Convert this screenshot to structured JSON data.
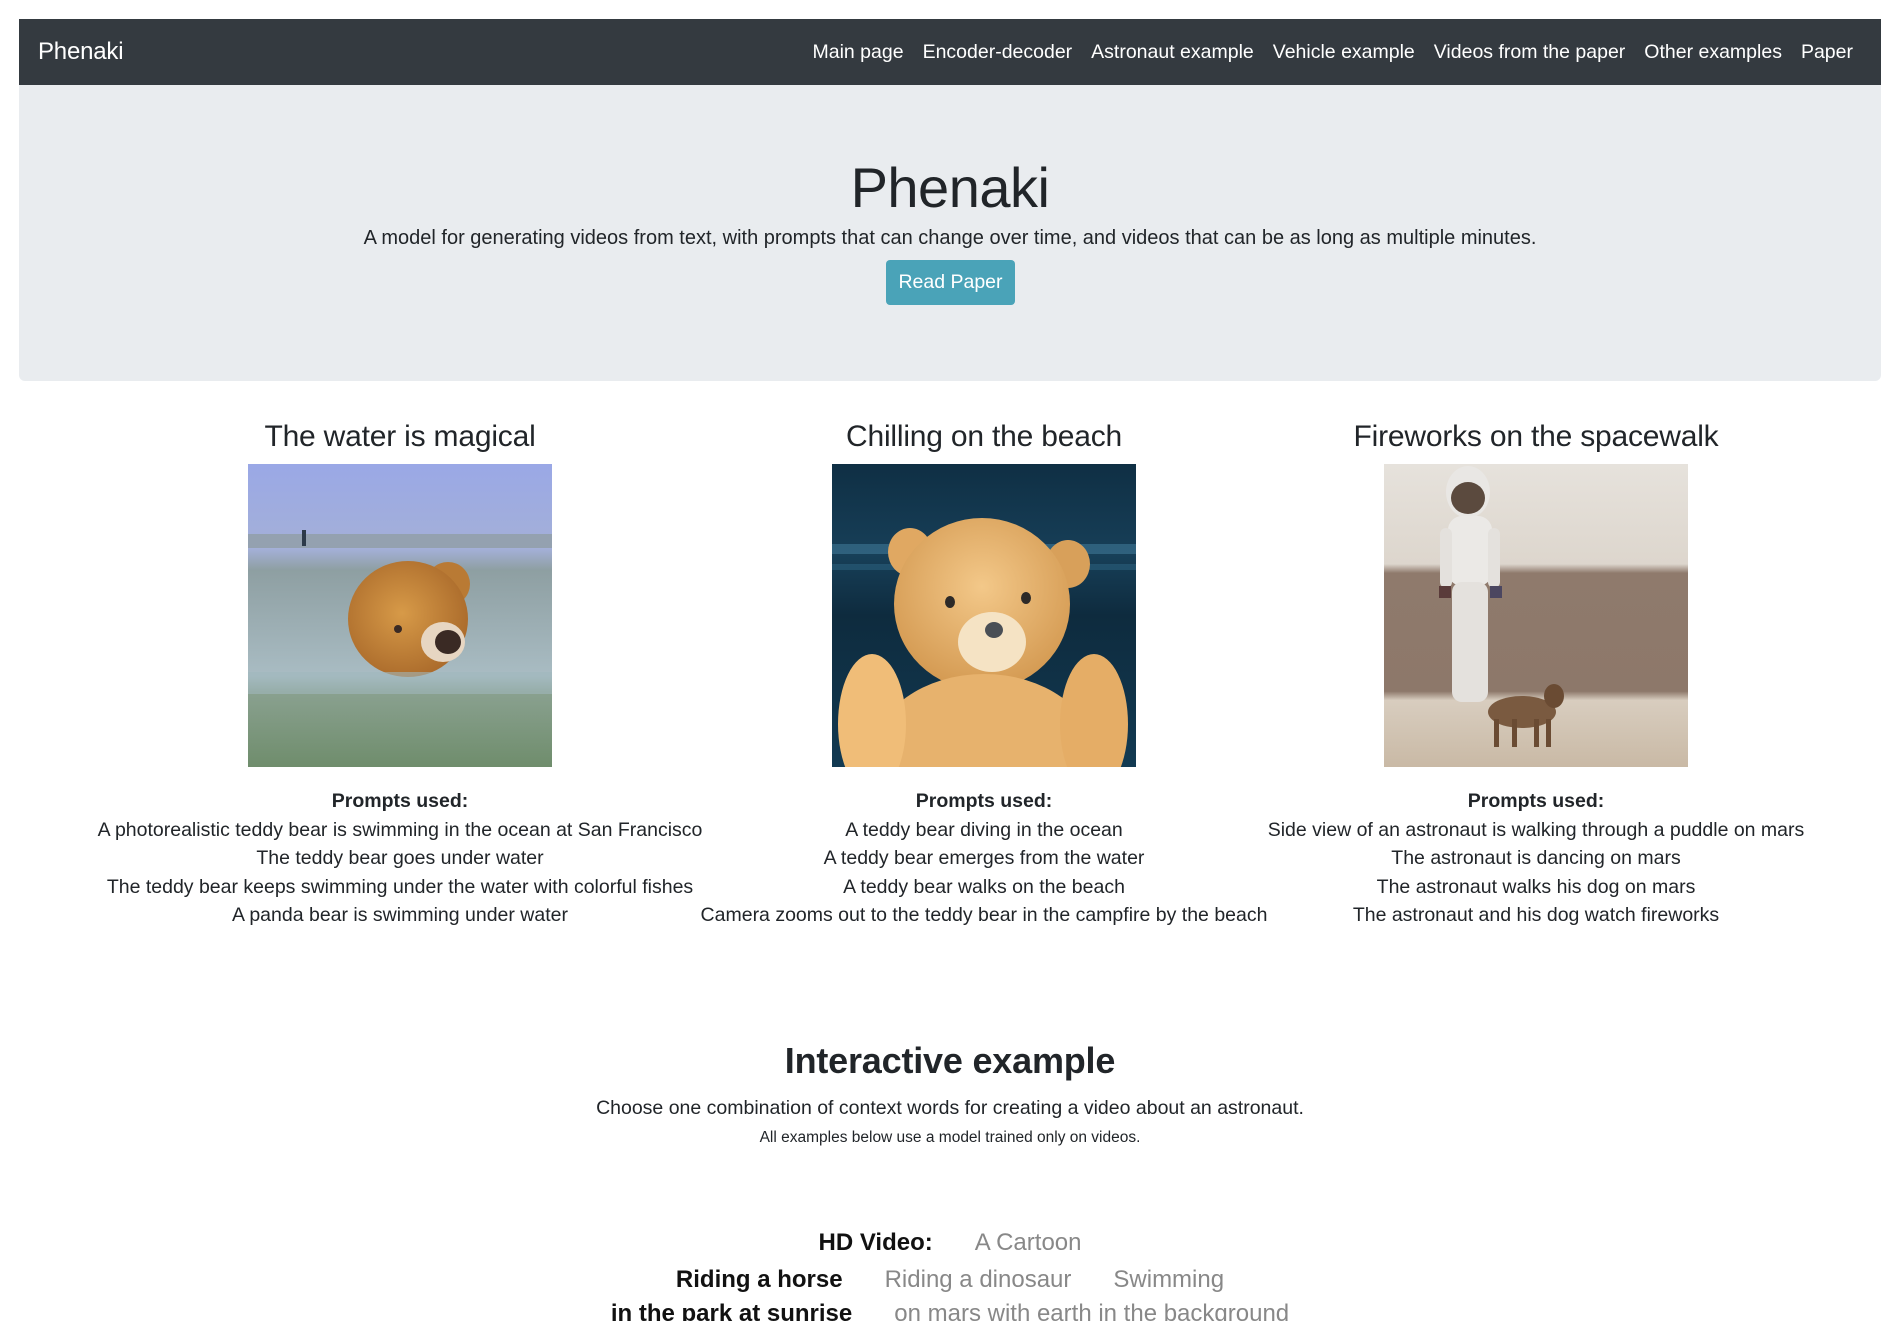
{
  "navbar": {
    "brand": "Phenaki",
    "links": [
      {
        "label": "Main page"
      },
      {
        "label": "Encoder-decoder"
      },
      {
        "label": "Astronaut example"
      },
      {
        "label": "Vehicle example"
      },
      {
        "label": "Videos from the paper"
      },
      {
        "label": "Other examples"
      },
      {
        "label": "Paper"
      }
    ]
  },
  "hero": {
    "title": "Phenaki",
    "subtitle": "A model for generating videos from text, with prompts that can change over time, and videos that can be as long as multiple minutes.",
    "button_label": "Read Paper",
    "button_color": "#4aa3b8"
  },
  "examples": [
    {
      "title": "The water is magical",
      "media": "teddy-bear-swimming-video",
      "prompts_label": "Prompts used:",
      "prompts": [
        "A photorealistic teddy bear is swimming in the ocean at San Francisco",
        "The teddy bear goes under water",
        "The teddy bear keeps swimming under the water with colorful fishes",
        "A panda bear is swimming under water"
      ]
    },
    {
      "title": "Chilling on the beach",
      "media": "teddy-bear-beach-video",
      "prompts_label": "Prompts used:",
      "prompts": [
        "A teddy bear diving in the ocean",
        "A teddy bear emerges from the water",
        "A teddy bear walks on the beach",
        "Camera zooms out to the teddy bear in the campfire by the beach"
      ]
    },
    {
      "title": "Fireworks on the spacewalk",
      "media": "astronaut-dog-mars-video",
      "prompts_label": "Prompts used:",
      "prompts": [
        "Side view of an astronaut is walking through a puddle on mars",
        "The astronaut is dancing on mars",
        "The astronaut walks his dog on mars",
        "The astronaut and his dog watch fireworks"
      ]
    }
  ],
  "interactive": {
    "title": "Interactive example",
    "description": "Choose one combination of context words for creating a video about an astronaut.",
    "note": "All examples below use a model trained only on videos.",
    "rows": [
      {
        "options": [
          {
            "label": "HD Video:",
            "selected": true
          },
          {
            "label": "A Cartoon",
            "selected": false
          }
        ]
      },
      {
        "options": [
          {
            "label": "Riding a horse",
            "selected": true
          },
          {
            "label": "Riding a dinosaur",
            "selected": false
          },
          {
            "label": "Swimming",
            "selected": false
          }
        ]
      },
      {
        "options": [
          {
            "label": "in the park at sunrise",
            "selected": true
          },
          {
            "label": "on mars with earth in the background",
            "selected": false
          }
        ]
      }
    ]
  }
}
